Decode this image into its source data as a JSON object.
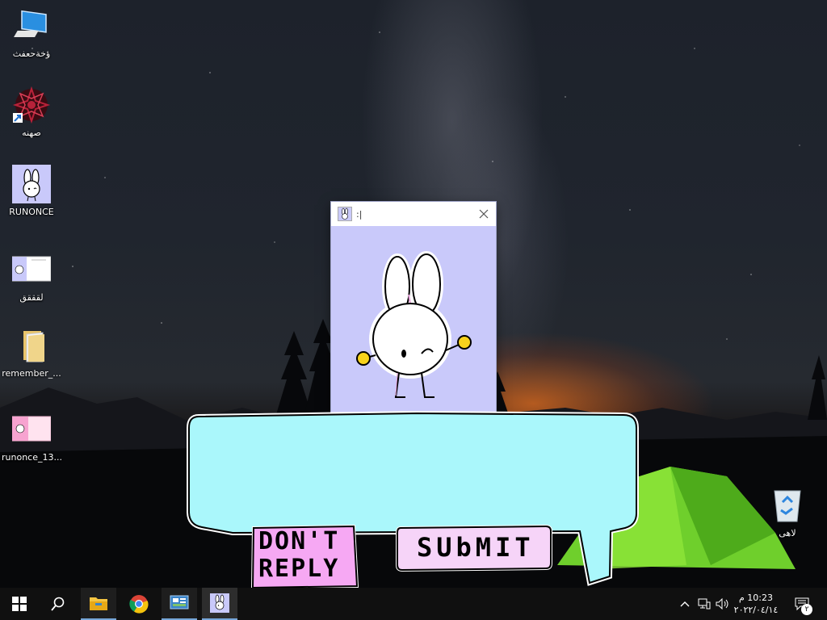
{
  "desktop": {
    "icons": [
      {
        "label": "ؤخةحعفث",
        "icon": "computer-icon"
      },
      {
        "label": "صهنه",
        "icon": "mandala-shortcut-icon"
      },
      {
        "label": "RUNONCE",
        "icon": "bunny-app-icon"
      },
      {
        "label": "لقققق",
        "icon": "image-thumbnail-icon"
      },
      {
        "label": "remember_...",
        "icon": "folder-icon"
      },
      {
        "label": "runonce_13...",
        "icon": "pink-image-icon"
      },
      {
        "label": "لاهى",
        "icon": "recycle-bin-icon"
      }
    ]
  },
  "app_window": {
    "title": ":|",
    "background": "#c9c9fa"
  },
  "speech_bubble": {
    "input_value": "",
    "fill": "#aaf7fb",
    "dont_reply_line1": "DON'T",
    "dont_reply_line2": "REPLY",
    "submit_label": "SUbMIT",
    "dont_reply_color": "#f6a8f3",
    "submit_color": "#f6d4f8"
  },
  "taskbar": {
    "start_icon": "windows-icon",
    "search_icon": "search-icon",
    "apps": [
      {
        "name": "file-explorer-icon",
        "active": true
      },
      {
        "name": "chrome-icon",
        "active": false
      },
      {
        "name": "control-panel-icon",
        "active": true
      },
      {
        "name": "bunny-app-icon",
        "active": true
      }
    ],
    "clock": {
      "time": "10:23 م",
      "date": "٢٠٢٢/٠٤/١٤"
    },
    "notification_count": "٢"
  }
}
